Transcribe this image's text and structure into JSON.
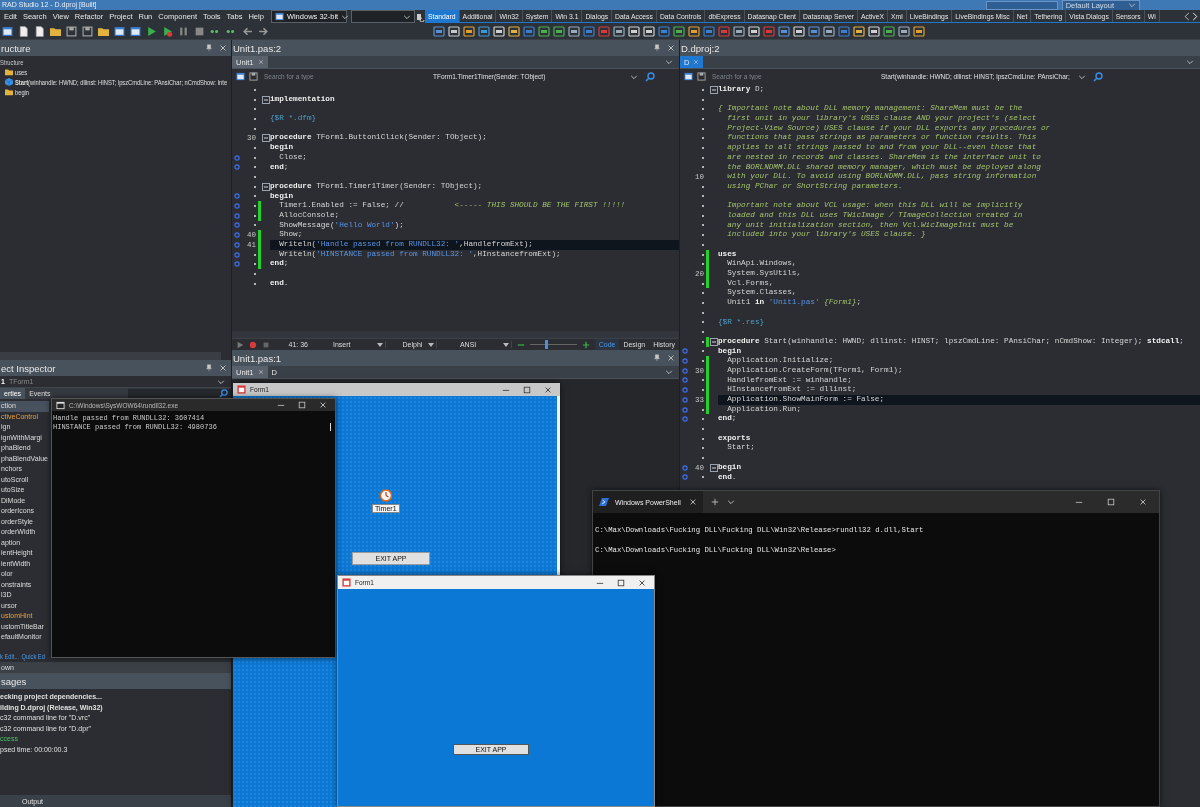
{
  "window": {
    "title": "RAD Studio 12 - D.dproj [Built]",
    "layout": "Default Layout"
  },
  "menu": [
    "Edit",
    "Search",
    "View",
    "Refactor",
    "Project",
    "Run",
    "Component",
    "Tools",
    "Tabs",
    "Help"
  ],
  "platform": "Windows 32-bit",
  "palette_tabs": [
    {
      "label": "Standard",
      "selected": true
    },
    {
      "label": "Additional",
      "selected": false
    },
    {
      "label": "Win32",
      "selected": false
    },
    {
      "label": "System",
      "selected": false
    },
    {
      "label": "Win 3.1",
      "selected": false
    },
    {
      "label": "Dialogs",
      "selected": false
    },
    {
      "label": "Data Access",
      "selected": false
    },
    {
      "label": "Data Controls",
      "selected": false
    },
    {
      "label": "dbExpress",
      "selected": false
    },
    {
      "label": "Datasnap Client",
      "selected": false
    },
    {
      "label": "Datasnap Server",
      "selected": false
    },
    {
      "label": "ActiveX",
      "selected": false
    },
    {
      "label": "Xml",
      "selected": false
    },
    {
      "label": "LiveBindings",
      "selected": false
    },
    {
      "label": "LiveBindings Misc",
      "selected": false
    },
    {
      "label": "Net",
      "selected": false
    },
    {
      "label": "Tethering",
      "selected": false
    },
    {
      "label": "Vista Dialogs",
      "selected": false
    },
    {
      "label": "Sensors",
      "selected": false
    },
    {
      "label": "Wi",
      "selected": false
    }
  ],
  "structure": {
    "title": "ructure",
    "tree": [
      {
        "label": "Structure",
        "kind": "root",
        "children": [
          {
            "label": "uses",
            "kind": "folder"
          },
          {
            "label": "**Start**(winhandle: HWND; dllinst: HINST; lpszCmdLine: PAnsiChar; nCmdShow: Inte",
            "kind": "procedure"
          },
          {
            "label": "begin",
            "kind": "folder"
          }
        ]
      }
    ]
  },
  "object_inspector": {
    "title": "ect Inspector",
    "object": "1",
    "object_type": "TForm1",
    "tabs": [
      {
        "label": "erties",
        "selected": true
      },
      {
        "label": "Events",
        "selected": false
      }
    ],
    "properties": [
      {
        "name": "ction",
        "kind": "plain",
        "selected": true
      },
      {
        "name": "ctiveControl",
        "kind": "reference",
        "selected": false
      },
      {
        "name": "ign",
        "kind": "plain",
        "selected": false
      },
      {
        "name": "ignWithMargi",
        "kind": "plain",
        "selected": false
      },
      {
        "name": "phaBlend",
        "kind": "plain",
        "selected": false
      },
      {
        "name": "phaBlendValue",
        "kind": "plain",
        "selected": false
      },
      {
        "name": "nchors",
        "kind": "plain",
        "selected": false
      },
      {
        "name": "utoScroll",
        "kind": "plain",
        "selected": false
      },
      {
        "name": "utoSize",
        "kind": "plain",
        "selected": false
      },
      {
        "name": "DiMode",
        "kind": "plain",
        "selected": false
      },
      {
        "name": "orderIcons",
        "kind": "plain",
        "selected": false
      },
      {
        "name": "orderStyle",
        "kind": "plain",
        "selected": false
      },
      {
        "name": "orderWidth",
        "kind": "plain",
        "selected": false
      },
      {
        "name": "aption",
        "kind": "plain",
        "selected": false
      },
      {
        "name": "ientHeight",
        "kind": "plain",
        "selected": false
      },
      {
        "name": "ientWidth",
        "kind": "plain",
        "selected": false
      },
      {
        "name": "olor",
        "kind": "plain",
        "selected": false
      },
      {
        "name": "onstraints",
        "kind": "plain",
        "selected": false
      },
      {
        "name": "l3D",
        "kind": "plain",
        "selected": false
      },
      {
        "name": "ursor",
        "kind": "plain",
        "selected": false
      },
      {
        "name": "ustomHint",
        "kind": "reference",
        "selected": false
      },
      {
        "name": "ustomTitleBar",
        "kind": "plain",
        "selected": false
      },
      {
        "name": "efaultMonitor",
        "kind": "plain",
        "selected": false
      }
    ],
    "links": [
      "k Edit...",
      "Quick Ed"
    ]
  },
  "status_text": "own",
  "messages": {
    "title": "sages",
    "lines": [
      {
        "text": "ecking project dependencies...",
        "kind": "bold"
      },
      {
        "text": "ilding D.dproj (Release, Win32)",
        "kind": "bold"
      },
      {
        "text": "c32 command line for \"D.vrc\"",
        "kind": "plain"
      },
      {
        "text": "c32 command line for \"D.dpr\"",
        "kind": "plain"
      },
      {
        "text": "ccess",
        "kind": "success"
      },
      {
        "text": "psed time: 00:00:00.3",
        "kind": "plain"
      }
    ]
  },
  "bottom_tabs": [
    {
      "label": "Output",
      "selected": false
    }
  ],
  "editors": [
    {
      "title": "Unit1.pas:2",
      "active": false,
      "tabs": [
        {
          "label": "Unit1",
          "selected": true,
          "closable": true
        }
      ],
      "search_placeholder": "Search for a type",
      "method": "TForm1.Timer1Timer(Sender: TObject)",
      "lines": [
        {
          "executable": false,
          "modified": false,
          "current": false,
          "fold": false
        },
        {
          "executable": false,
          "modified": false,
          "current": false,
          "fold": true,
          "segments": [
            {
              "kind": "keyword",
              "text": "implementation"
            }
          ]
        },
        {
          "executable": false,
          "modified": false,
          "current": false,
          "fold": false
        },
        {
          "executable": false,
          "modified": false,
          "current": false,
          "fold": false,
          "segments": [
            {
              "kind": "directive",
              "text": "{$R *.dfm}"
            }
          ]
        },
        {
          "executable": false,
          "modified": false,
          "current": false,
          "fold": false
        },
        {
          "number": "30",
          "executable": false,
          "modified": false,
          "current": false,
          "fold": true,
          "segments": [
            {
              "kind": "keyword",
              "text": "procedure"
            },
            {
              "kind": "plain",
              "text": " TForm1.Button1Click(Sender: TObject);"
            }
          ]
        },
        {
          "executable": false,
          "modified": false,
          "current": false,
          "fold": false,
          "segments": [
            {
              "kind": "keyword",
              "text": "begin"
            }
          ]
        },
        {
          "executable": true,
          "modified": false,
          "current": false,
          "fold": false,
          "segments": [
            {
              "kind": "plain",
              "text": "  Close;"
            }
          ]
        },
        {
          "executable": true,
          "modified": false,
          "current": false,
          "fold": false,
          "segments": [
            {
              "kind": "keyword",
              "text": "end"
            },
            {
              "kind": "plain",
              "text": ";"
            }
          ]
        },
        {
          "executable": false,
          "modified": false,
          "current": false,
          "fold": false
        },
        {
          "executable": false,
          "modified": false,
          "current": false,
          "fold": true,
          "segments": [
            {
              "kind": "keyword",
              "text": "procedure"
            },
            {
              "kind": "plain",
              "text": " TForm1.Timer1Timer(Sender: TObject);"
            }
          ]
        },
        {
          "executable": true,
          "modified": false,
          "current": false,
          "fold": false,
          "segments": [
            {
              "kind": "keyword",
              "text": "begin"
            }
          ]
        },
        {
          "executable": true,
          "modified": true,
          "current": false,
          "fold": false,
          "segments": [
            {
              "kind": "plain",
              "text": "  Timer1.Enabled := False; // "
            },
            {
              "kind": "comment",
              "text": "          <----- THIS SHOULD BE THE FIRST !!!!!"
            }
          ]
        },
        {
          "executable": true,
          "modified": true,
          "current": false,
          "fold": false,
          "segments": [
            {
              "kind": "plain",
              "text": "  AllocConsole;"
            }
          ]
        },
        {
          "executable": true,
          "modified": false,
          "current": false,
          "fold": false,
          "segments": [
            {
              "kind": "plain",
              "text": "  ShowMessage("
            },
            {
              "kind": "string",
              "text": "'Hello World'"
            },
            {
              "kind": "plain",
              "text": ");"
            }
          ]
        },
        {
          "number": "40",
          "executable": true,
          "modified": true,
          "current": false,
          "fold": false,
          "segments": [
            {
              "kind": "plain",
              "text": "  Show;"
            }
          ]
        },
        {
          "number": "41",
          "executable": true,
          "modified": true,
          "current": true,
          "fold": false,
          "segments": [
            {
              "kind": "plain",
              "text": "  Writeln("
            },
            {
              "kind": "string",
              "text": "'Handle passed from RUNDLL32: '"
            },
            {
              "kind": "plain",
              "text": ",HandlefromExt);"
            }
          ]
        },
        {
          "executable": true,
          "modified": true,
          "current": false,
          "fold": false,
          "segments": [
            {
              "kind": "plain",
              "text": "  Writeln("
            },
            {
              "kind": "string",
              "text": "'HINSTANCE passed from RUNDLL32: '"
            },
            {
              "kind": "plain",
              "text": ",HInstancefromExt);"
            }
          ]
        },
        {
          "executable": true,
          "modified": true,
          "current": false,
          "fold": false,
          "segments": [
            {
              "kind": "keyword",
              "text": "end"
            },
            {
              "kind": "plain",
              "text": ";"
            }
          ]
        },
        {
          "executable": false,
          "modified": false,
          "current": false,
          "fold": false
        },
        {
          "executable": false,
          "modified": false,
          "current": false,
          "fold": false,
          "segments": [
            {
              "kind": "keyword",
              "text": "end"
            },
            {
              "kind": "plain",
              "text": "."
            }
          ]
        }
      ],
      "status": {
        "position": "41: 36",
        "mode": "Insert",
        "language": "Delphi",
        "encoding": "ANSI",
        "zoom": {
          "level": 0.33
        },
        "views": [
          {
            "label": "Code",
            "selected": true
          },
          {
            "label": "Design",
            "selected": false
          },
          {
            "label": "History",
            "selected": false
          }
        ]
      }
    },
    {
      "title": "D.dproj:2",
      "active": true,
      "tabs": [
        {
          "label": "D",
          "selected": true,
          "closable": true
        }
      ],
      "search_placeholder": "Search for a type",
      "method": "Start(winhandle: HWND; dllinst: HINST; lpszCmdLine: PAnsiChar;",
      "lines": [
        {
          "executable": false,
          "modified": false,
          "current": false,
          "fold": true,
          "segments": [
            {
              "kind": "keyword",
              "text": "library"
            },
            {
              "kind": "plain",
              "text": " D;"
            }
          ]
        },
        {
          "executable": false,
          "modified": false,
          "current": false,
          "fold": false
        },
        {
          "executable": false,
          "modified": false,
          "current": false,
          "fold": false,
          "segments": [
            {
              "kind": "comment",
              "text": "{ Important note about DLL memory management: ShareMem must be the"
            }
          ]
        },
        {
          "executable": false,
          "modified": false,
          "current": false,
          "fold": false,
          "segments": [
            {
              "kind": "comment",
              "text": "  first unit in your library's USES clause AND your project's (select"
            }
          ]
        },
        {
          "executable": false,
          "modified": false,
          "current": false,
          "fold": false,
          "segments": [
            {
              "kind": "comment",
              "text": "  Project-View Source) USES clause if your DLL exports any procedures or"
            }
          ]
        },
        {
          "executable": false,
          "modified": false,
          "current": false,
          "fold": false,
          "segments": [
            {
              "kind": "comment",
              "text": "  functions that pass strings as parameters or function results. This"
            }
          ]
        },
        {
          "executable": false,
          "modified": false,
          "current": false,
          "fold": false,
          "segments": [
            {
              "kind": "comment",
              "text": "  applies to all strings passed to and from your DLL--even those that"
            }
          ]
        },
        {
          "executable": false,
          "modified": false,
          "current": false,
          "fold": false,
          "segments": [
            {
              "kind": "comment",
              "text": "  are nested in records and classes. ShareMem is the interface unit to"
            }
          ]
        },
        {
          "executable": false,
          "modified": false,
          "current": false,
          "fold": false,
          "segments": [
            {
              "kind": "comment",
              "text": "  the BORLNDMM.DLL shared memory manager, which must be deployed along"
            }
          ]
        },
        {
          "number": "10",
          "executable": false,
          "modified": false,
          "current": false,
          "fold": false,
          "segments": [
            {
              "kind": "comment",
              "text": "  with your DLL. To avoid using BORLNDMM.DLL, pass string information"
            }
          ]
        },
        {
          "executable": false,
          "modified": false,
          "current": false,
          "fold": false,
          "segments": [
            {
              "kind": "comment",
              "text": "  using PChar or ShortString parameters."
            }
          ]
        },
        {
          "executable": false,
          "modified": false,
          "current": false,
          "fold": false
        },
        {
          "executable": false,
          "modified": false,
          "current": false,
          "fold": false,
          "segments": [
            {
              "kind": "comment",
              "text": "  Important note about VCL usage: when this DLL will be implicitly"
            }
          ]
        },
        {
          "executable": false,
          "modified": false,
          "current": false,
          "fold": false,
          "segments": [
            {
              "kind": "comment",
              "text": "  loaded and this DLL uses TWicImage / TImageCollection created in"
            }
          ]
        },
        {
          "executable": false,
          "modified": false,
          "current": false,
          "fold": false,
          "segments": [
            {
              "kind": "comment",
              "text": "  any unit initialization section, then Vcl.WicImageInit must be"
            }
          ]
        },
        {
          "executable": false,
          "modified": false,
          "current": false,
          "fold": false,
          "segments": [
            {
              "kind": "comment",
              "text": "  included into your library's USES clause. }"
            }
          ]
        },
        {
          "executable": false,
          "modified": false,
          "current": false,
          "fold": false
        },
        {
          "executable": false,
          "modified": true,
          "current": false,
          "fold": false,
          "segments": [
            {
              "kind": "keyword",
              "text": "uses"
            }
          ]
        },
        {
          "executable": false,
          "modified": true,
          "current": false,
          "fold": false,
          "segments": [
            {
              "kind": "plain",
              "text": "  WinApi.Windows,"
            }
          ]
        },
        {
          "number": "20",
          "executable": false,
          "modified": true,
          "current": false,
          "fold": false,
          "segments": [
            {
              "kind": "plain",
              "text": "  System.SysUtils,"
            }
          ]
        },
        {
          "executable": false,
          "modified": true,
          "current": false,
          "fold": false,
          "segments": [
            {
              "kind": "plain",
              "text": "  Vcl.Forms,"
            }
          ]
        },
        {
          "executable": false,
          "modified": false,
          "current": false,
          "fold": false,
          "segments": [
            {
              "kind": "plain",
              "text": "  System.Classes,"
            }
          ]
        },
        {
          "executable": false,
          "modified": false,
          "current": false,
          "fold": false,
          "segments": [
            {
              "kind": "plain",
              "text": "  Unit1 "
            },
            {
              "kind": "keyword",
              "text": "in"
            },
            {
              "kind": "string",
              "text": " 'Unit1.pas'"
            },
            {
              "kind": "comment",
              "text": " {Form1}"
            },
            {
              "kind": "plain",
              "text": ";"
            }
          ]
        },
        {
          "executable": false,
          "modified": false,
          "current": false,
          "fold": false
        },
        {
          "executable": false,
          "modified": false,
          "current": false,
          "fold": false,
          "segments": [
            {
              "kind": "directive",
              "text": "{$R *.res}"
            }
          ]
        },
        {
          "executable": false,
          "modified": false,
          "current": false,
          "fold": false
        },
        {
          "executable": false,
          "modified": true,
          "current": false,
          "fold": true,
          "segments": [
            {
              "kind": "keyword",
              "text": "procedure"
            },
            {
              "kind": "plain",
              "text": " Start(winhandle: HWND; dllinst: HINST; lpszCmdLine: PAnsiChar; nCmdShow: Integer); "
            },
            {
              "kind": "keyword",
              "text": "stdcall"
            },
            {
              "kind": "plain",
              "text": ";"
            }
          ]
        },
        {
          "executable": true,
          "modified": false,
          "current": false,
          "fold": false,
          "segments": [
            {
              "kind": "keyword",
              "text": "begin"
            }
          ]
        },
        {
          "executable": true,
          "modified": true,
          "current": false,
          "fold": false,
          "segments": [
            {
              "kind": "plain",
              "text": "  Application.Initialize;"
            }
          ]
        },
        {
          "number": "30",
          "executable": true,
          "modified": true,
          "current": false,
          "fold": false,
          "segments": [
            {
              "kind": "plain",
              "text": "  Application.CreateForm(TForm1, Form1);"
            }
          ]
        },
        {
          "executable": true,
          "modified": true,
          "current": false,
          "fold": false,
          "segments": [
            {
              "kind": "plain",
              "text": "  HandlefromExt := winhandle;"
            }
          ]
        },
        {
          "executable": true,
          "modified": true,
          "current": false,
          "fold": false,
          "segments": [
            {
              "kind": "plain",
              "text": "  HInstancefromExt := dllinst;"
            }
          ]
        },
        {
          "number": "33",
          "executable": true,
          "modified": true,
          "current": true,
          "fold": false,
          "segments": [
            {
              "kind": "plain",
              "text": "  Application.ShowMainForm := False;"
            }
          ]
        },
        {
          "executable": true,
          "modified": true,
          "current": false,
          "fold": false,
          "segments": [
            {
              "kind": "plain",
              "text": "  Application.Run;"
            }
          ]
        },
        {
          "executable": true,
          "modified": false,
          "current": false,
          "fold": false,
          "segments": [
            {
              "kind": "keyword",
              "text": "end"
            },
            {
              "kind": "plain",
              "text": ";"
            }
          ]
        },
        {
          "executable": false,
          "modified": false,
          "current": false,
          "fold": false
        },
        {
          "executable": false,
          "modified": false,
          "current": false,
          "fold": false,
          "segments": [
            {
              "kind": "keyword",
              "text": "exports"
            }
          ]
        },
        {
          "executable": false,
          "modified": false,
          "current": false,
          "fold": false,
          "segments": [
            {
              "kind": "plain",
              "text": "  Start;"
            }
          ]
        },
        {
          "executable": false,
          "modified": false,
          "current": false,
          "fold": false
        },
        {
          "number": "40",
          "executable": true,
          "modified": false,
          "current": false,
          "fold": true,
          "segments": [
            {
              "kind": "keyword",
              "text": "begin"
            }
          ]
        },
        {
          "executable": true,
          "modified": false,
          "current": false,
          "fold": false,
          "segments": [
            {
              "kind": "keyword",
              "text": "end"
            },
            {
              "kind": "plain",
              "text": "."
            }
          ]
        }
      ]
    }
  ],
  "designer_pane": {
    "title": "Unit1.pas:1",
    "tabs": [
      {
        "label": "Unit1",
        "selected": true,
        "closable": true
      },
      {
        "label": "D",
        "selected": false,
        "closable": false
      }
    ]
  },
  "windows": [
    {
      "kind": "form_designer",
      "title": "Form1",
      "component": "Timer1",
      "button": "EXIT APP"
    },
    {
      "kind": "console",
      "title": "C:\\Windows\\SysWOW64\\rundll32.exe",
      "lines": [
        "Handle passed from RUNDLL32: 3607414",
        "HINSTANCE passed from RUNDLL32: 4980736"
      ]
    },
    {
      "kind": "terminal",
      "title": "Windows PowerShell",
      "lines": [
        "C:\\Max\\Downloads\\Fucking DLL\\Fucking DLL\\Win32\\Release>rundll32 d.dll,Start",
        "C:\\Max\\Downloads\\Fucking DLL\\Fucking DLL\\Win32\\Release>"
      ]
    },
    {
      "kind": "form",
      "title": "Form1",
      "button": "EXIT APP"
    }
  ]
}
